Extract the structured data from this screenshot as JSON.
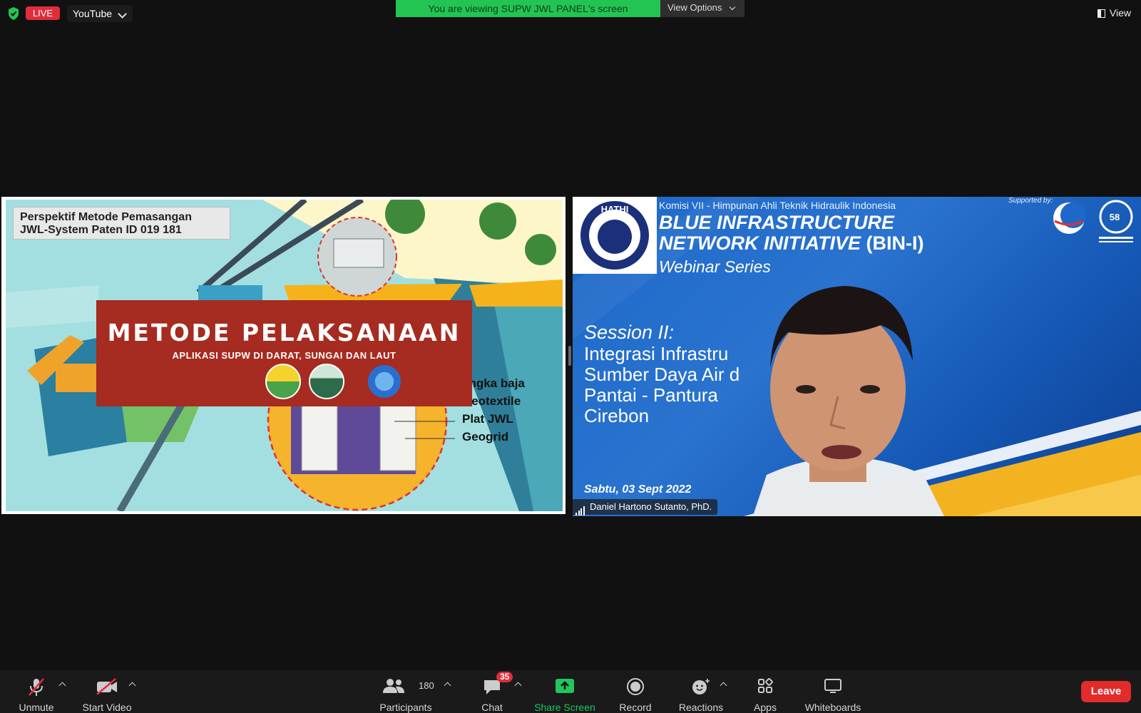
{
  "top_bar": {
    "live_label": "LIVE",
    "stream_target": "YouTube",
    "viewing_banner": "You are viewing SUPW JWL PANEL's screen",
    "view_options_label": "View Options",
    "view_label": "View"
  },
  "shared_screen": {
    "perspective_line1": "Perspektif Metode Pemasangan",
    "perspective_line2": "JWL-System Paten ID 019 181",
    "banner_title": "METODE PELAKSANAAN",
    "banner_subtitle": "APLIKASI SUPW DI DARAT, SUNGAI DAN LAUT",
    "callouts": [
      "angka baja",
      "Geotextile",
      "Plat JWL",
      "Geogrid"
    ]
  },
  "speaker_video": {
    "komisi": "Komisi VII - Himpunan Ahli Teknik Hidraulik Indonesia",
    "supported_by": "Supported by:",
    "title_line1": "BLUE INFRASTRUCTURE",
    "title_line2": "NETWORK INITIATIVE",
    "title_abbrev": "(BIN-I)",
    "series": "Webinar Series",
    "session": "Session II:",
    "topic": "Integrasi Infrastru\nSumber Daya Air d\nPantai - Pantura\nCirebon",
    "date": "Sabtu, 03 Sept 2022",
    "speaker_name": "Daniel Hartono Sutanto, PhD.",
    "logo_text": "HATHI",
    "badge_text": "58"
  },
  "toolbar": {
    "unmute": "Unmute",
    "start_video": "Start Video",
    "participants": "Participants",
    "participants_count": "180",
    "chat": "Chat",
    "chat_badge": "35",
    "share_screen": "Share Screen",
    "record": "Record",
    "reactions": "Reactions",
    "apps": "Apps",
    "whiteboards": "Whiteboards",
    "leave": "Leave"
  },
  "colors": {
    "live_red": "#e02d3c",
    "banner_green": "#23c552",
    "leave_red": "#e22b2b",
    "share_green": "#22c55e"
  }
}
